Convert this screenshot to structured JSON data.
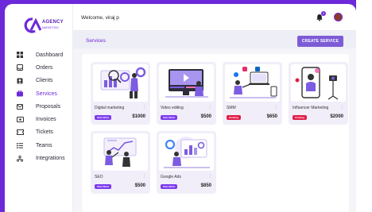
{
  "brand": {
    "name": "AGENCY",
    "sub": "MARKETING"
  },
  "header": {
    "welcome": "Welcome, viraj p",
    "notif_count": "0"
  },
  "sidebar": {
    "items": [
      {
        "label": "Dashboard",
        "icon": "dashboard-icon"
      },
      {
        "label": "Orders",
        "icon": "inbox-icon"
      },
      {
        "label": "Clients",
        "icon": "person-icon"
      },
      {
        "label": "Services",
        "icon": "services-icon",
        "active": true
      },
      {
        "label": "Proposals",
        "icon": "mail-icon"
      },
      {
        "label": "Invoices",
        "icon": "invoice-icon"
      },
      {
        "label": "Tickets",
        "icon": "ticket-icon"
      },
      {
        "label": "Teams",
        "icon": "list-icon"
      },
      {
        "label": "Integrations",
        "icon": "integrations-icon"
      }
    ]
  },
  "main": {
    "title": "Services",
    "create_label": "CREATE SERVICE"
  },
  "colors": {
    "accent": "#6d28d9",
    "status_started": "#7c3aed",
    "status_pending": "#e11d48"
  },
  "cards": [
    {
      "name": "Digital marketing",
      "status": "Start Work",
      "status_type": "started",
      "price": "$1000",
      "menu": "⋮"
    },
    {
      "name": "Video editing",
      "status": "Start Work",
      "status_type": "started",
      "price": "$500",
      "menu": "⋮"
    },
    {
      "name": "SMM",
      "status": "Pending",
      "status_type": "pending",
      "price": "$650",
      "menu": "⋮"
    },
    {
      "name": "Influencer Marketing",
      "status": "Pending",
      "status_type": "pending",
      "price": "$2000",
      "menu": "⋮"
    },
    {
      "name": "SEO",
      "status": "Start Work",
      "status_type": "started",
      "price": "$500",
      "menu": "⋮"
    },
    {
      "name": "Google Ads",
      "status": "Start Work",
      "status_type": "started",
      "price": "$850",
      "menu": "⋮"
    }
  ]
}
